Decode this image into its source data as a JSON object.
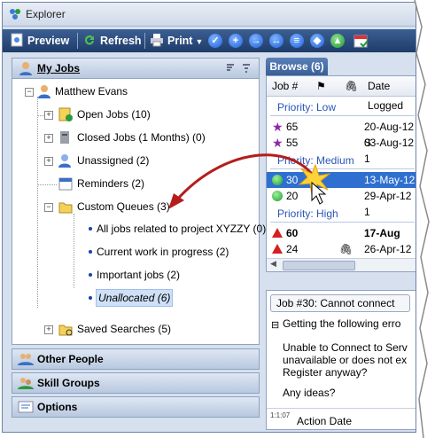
{
  "window": {
    "title": "Explorer"
  },
  "toolbar": {
    "preview": "Preview",
    "refresh": "Refresh",
    "print": "Print"
  },
  "left": {
    "my_jobs": "My Jobs",
    "user": "Matthew Evans",
    "open_jobs": "Open Jobs (10)",
    "closed_jobs": "Closed Jobs (1 Months) (0)",
    "unassigned": "Unassigned (2)",
    "reminders": "Reminders (2)",
    "custom_queues": "Custom Queues (3)",
    "q1": "All jobs related to project XYZZY (0)",
    "q2": "Current work in progress (2)",
    "q3": "Important jobs (2)",
    "q4": "Unallocated (6)",
    "saved": "Saved Searches (5)",
    "other_people": "Other People",
    "skill_groups": "Skill Groups",
    "options": "Options"
  },
  "browse": {
    "tab": "Browse (6)",
    "col_job": "Job #",
    "col_date": "Date Logged",
    "p_low": "Priority: Low",
    "p_medium": "Priority: Medium",
    "p_high": "Priority: High",
    "rows": [
      {
        "job": "65",
        "date": "20-Aug-12 S"
      },
      {
        "job": "55",
        "date": "03-Aug-12 1"
      },
      {
        "job": "30",
        "date": "13-May-12"
      },
      {
        "job": "20",
        "date": "29-Apr-12 1"
      },
      {
        "job": "60",
        "date": "17-Aug"
      },
      {
        "job": "24",
        "date": "26-Apr-12"
      }
    ]
  },
  "detail": {
    "title": "Job #30: Cannot connect",
    "subject": "Getting the following erro",
    "line1": "Unable to Connect to Serv",
    "line2": "unavailable or does not ex",
    "line3": "Register anyway?",
    "line4": "Any ideas?",
    "action_date": "Action Date"
  }
}
